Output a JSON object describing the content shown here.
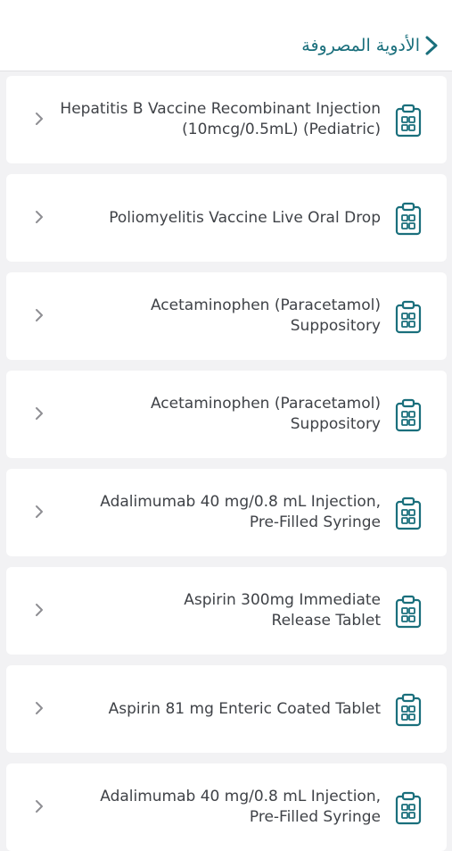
{
  "header": {
    "title": "الأدوية المصروفة",
    "back_icon": "chevron-right-icon",
    "accent_color": "#1a6f7c"
  },
  "list": {
    "item_icon": "clipboard-icon",
    "disclosure_icon": "chevron-right-icon",
    "items": [
      {
        "name": "Hepatitis B Vaccine Recombinant Injection (10mcg/0.5mL) (Pediatric)"
      },
      {
        "name": "Poliomyelitis Vaccine Live Oral Drop"
      },
      {
        "name": "Acetaminophen (Paracetamol) Suppository"
      },
      {
        "name": "Acetaminophen (Paracetamol) Suppository"
      },
      {
        "name": "Adalimumab 40 mg/0.8 mL Injection, Pre-Filled Syringe"
      },
      {
        "name": "Aspirin 300mg Immediate Release Tablet"
      },
      {
        "name": "Aspirin 81 mg Enteric Coated Tablet"
      },
      {
        "name": "Adalimumab 40 mg/0.8 mL Injection, Pre-Filled Syringe"
      }
    ]
  }
}
